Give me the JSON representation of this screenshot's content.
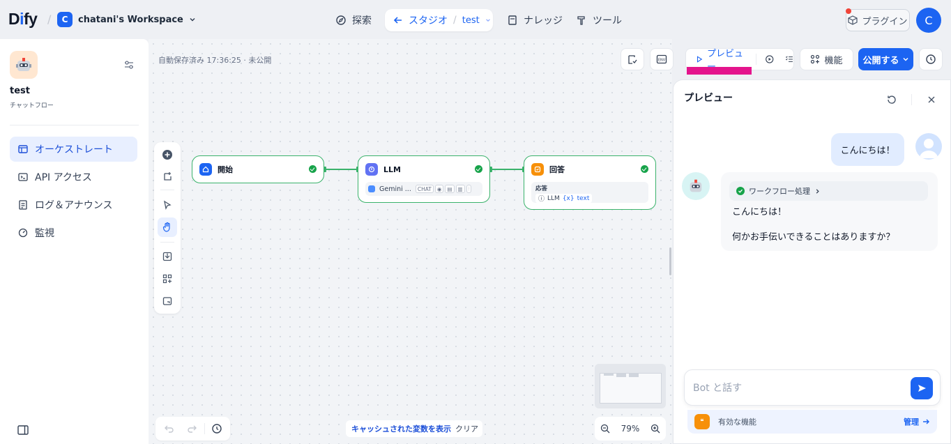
{
  "brand": {
    "logo": "Dify"
  },
  "workspace": {
    "badge": "C",
    "name": "chatani's Workspace"
  },
  "nav": {
    "explore": "探索",
    "studio": "スタジオ",
    "app": "test",
    "knowledge": "ナレッジ",
    "tools": "ツール",
    "plugins": "プラグイン",
    "user_initial": "C"
  },
  "sidebar": {
    "app_name": "test",
    "app_type": "チャットフロー",
    "items": [
      {
        "label": "オーケストレート",
        "icon": "layout-icon"
      },
      {
        "label": "API アクセス",
        "icon": "terminal-icon"
      },
      {
        "label": "ログ＆アナウンス",
        "icon": "document-icon"
      },
      {
        "label": "監視",
        "icon": "gauge-icon"
      }
    ]
  },
  "canvas": {
    "autosave": "自動保存済み 17:36:25 · 未公開",
    "nodes": {
      "start": {
        "title": "開始"
      },
      "llm": {
        "title": "LLM",
        "model": "Gemini ...",
        "chip": "CHAT"
      },
      "answer": {
        "title": "回答",
        "label": "応答",
        "source": "LLM",
        "var": "text"
      }
    },
    "cache_button": "キャッシュされた変数を表示",
    "clear_button": "クリア",
    "zoom": "79%"
  },
  "header": {
    "preview": "プレビュー",
    "features": "機能",
    "publish": "公開する"
  },
  "preview": {
    "title": "プレビュー",
    "user_message": "こんにちは！",
    "workflow_label": "ワークフロー処理",
    "bot_line1": "こんにちは！",
    "bot_line2": "何かお手伝いできることはありますか？",
    "input_placeholder": "Bot と話す",
    "features_label": "有効な機能",
    "manage_label": "管理"
  },
  "colors": {
    "accent": "#1c64f2",
    "node_border": "#3ab26b",
    "highlight": "#e4148c"
  }
}
